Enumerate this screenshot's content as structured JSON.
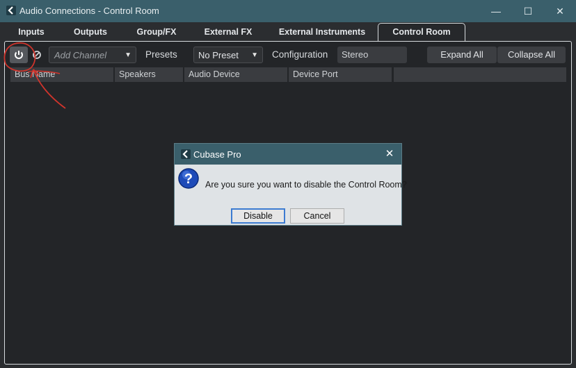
{
  "window": {
    "title": "Audio Connections - Control Room",
    "controls": {
      "minimize": "—",
      "maximize": "☐",
      "close": "✕"
    }
  },
  "tabs": [
    {
      "label": "Inputs",
      "active": false
    },
    {
      "label": "Outputs",
      "active": false
    },
    {
      "label": "Group/FX",
      "active": false
    },
    {
      "label": "External FX",
      "active": false
    },
    {
      "label": "External Instruments",
      "active": false
    },
    {
      "label": "Control Room",
      "active": true
    }
  ],
  "toolbar": {
    "power_icon": "power-icon",
    "disable_icon": "no-entry-icon",
    "add_channel": "Add Channel",
    "presets_label": "Presets",
    "preset_value": "No Preset",
    "configuration_label": "Configuration",
    "configuration_value": "Stereo",
    "expand_all": "Expand All",
    "collapse_all": "Collapse All"
  },
  "table": {
    "columns": [
      "Bus Name",
      "Speakers",
      "Audio Device",
      "Device Port",
      ""
    ]
  },
  "dialog": {
    "title": "Cubase Pro",
    "message": "Are you sure you want to disable the Control Room?",
    "icon": "question-icon",
    "disable_button": "Disable",
    "cancel_button": "Cancel",
    "close": "✕"
  },
  "colors": {
    "titlebar": "#3a5f6b",
    "panel": "#232528",
    "annotation": "#d0342c",
    "primary_border": "#3c7bd1"
  }
}
